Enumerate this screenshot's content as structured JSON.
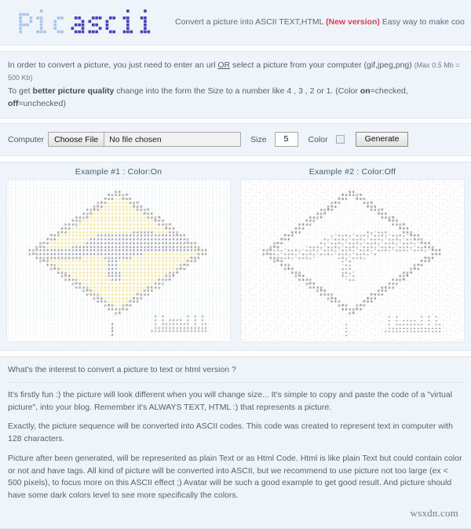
{
  "header": {
    "logo_text_light": "pic",
    "logo_text_dark": "ascii",
    "logo_color_light": "#a9c6ea",
    "logo_color_dark": "#4a3ec0",
    "tagline_part1": "Convert a picture into ASCII TEXT,HTML ",
    "tagline_new_version": "(New version)",
    "tagline_part2": " Easy way to make cool ascii art...",
    "new_version_color": "#d93b4e"
  },
  "instructions": {
    "line1_a": "In order to convert a picture, you just need to enter an url ",
    "line1_or": "OR",
    "line1_b": " select a picture from your computer (gif,jpeg,png) ",
    "line1_max": "(Max 0.5 Mb = 500 Kb)",
    "line2_a": "To get ",
    "line2_bold": "better picture quality",
    "line2_b": " change into the form the Size to a number like 4 , 3 , 2 or 1. (Color ",
    "line2_on": "on",
    "line2_c": "=checked, ",
    "line2_off": "off",
    "line2_d": "=unchecked)"
  },
  "form": {
    "computer_label": "Computer",
    "choose_file_label": "Choose File",
    "no_file_text": "No file chosen",
    "size_label": "Size",
    "size_value": "5",
    "color_label": "Color",
    "color_checked": false,
    "generate_label": "Generate"
  },
  "examples": [
    {
      "title": "Example #1 : Color:On",
      "mode": "color"
    },
    {
      "title": "Example #2 : Color:Off",
      "mode": "mono"
    }
  ],
  "info": {
    "question": "What's the interest to convert a picture to text or html version ?",
    "p1": "It's firstly fun :) the picture will look different when you will change size... It's simple to copy and paste the code of a \"virtual picture\", into your blog. Remember it's ALWAYS TEXT, HTML :) that represents a picture.",
    "p2": "Exactly, the picture sequence will be converted into ASCII codes. This code was created to represent text in computer with 128 characters.",
    "p3": "Picture after been generated, will be represented as plain Text or as Html Code. Html is like plain Text but could contain color or not and have tags. All kind of picture will be converted into ASCII, but we recommend to use picture not too large (ex < 500 pixels), to focus more on this ASCII effect ;) Avatar will be such a good example to get good result. And picture should have some dark colors level to see more specifically the colors."
  },
  "watermark": "wsxdn.com",
  "palette": {
    "panel_bg": "#eef4fa",
    "panel_border": "#dbe6f0",
    "text": "#53636f",
    "art_sign_yellow": "#e8c72c",
    "art_sign_dark": "#2f3a52",
    "art_sky": "#c3d3e4"
  }
}
